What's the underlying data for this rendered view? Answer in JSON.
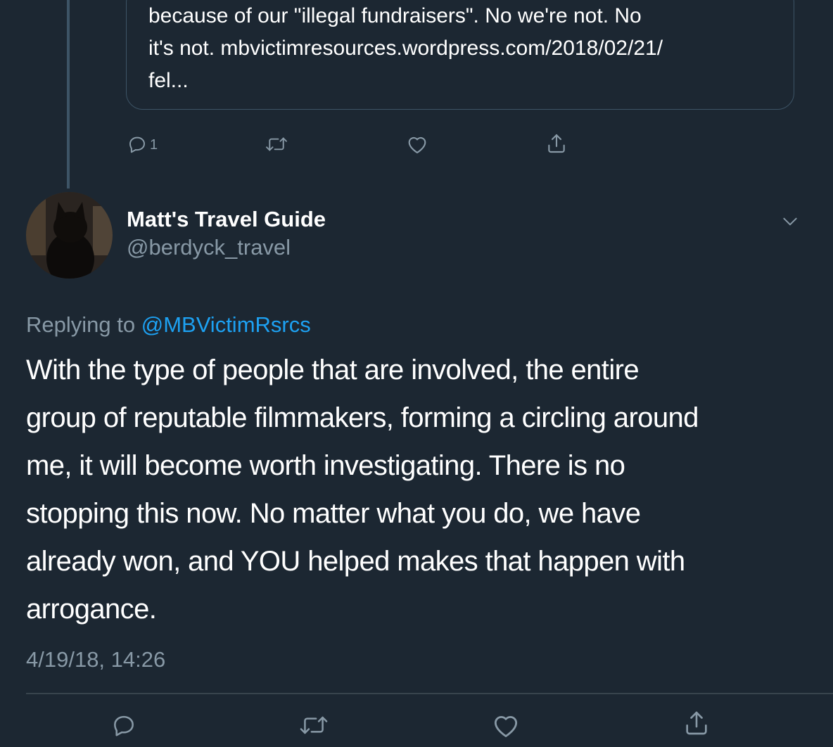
{
  "quoted_tweet": {
    "text_line1": "because of our \"illegal fundraisers\". No we're not. No",
    "text_line2": "it's not. mbvictimresources.wordpress.com/2018/02/21/",
    "text_line3": "fel..."
  },
  "parent_actions": {
    "reply_count": "1",
    "icons": [
      "reply-icon",
      "retweet-icon",
      "like-icon",
      "share-icon"
    ]
  },
  "tweet": {
    "display_name": "Matt's Travel Guide",
    "handle": "@berdyck_travel",
    "replying_prefix": "Replying to ",
    "replying_to": "@MBVictimRsrcs",
    "body": "With the type of people that are involved, the entire\ngroup of reputable filmmakers, forming a circling around\nme, it will become worth investigating.  There is no\nstopping this now. No matter what you do, we have\nalready won, and YOU helped makes that happen with\narrogance.",
    "timestamp": "4/19/18, 14:26"
  },
  "colors": {
    "background": "#1c2732",
    "secondary_text": "#8899a6",
    "link": "#1da1f2",
    "border": "#3d5466"
  }
}
